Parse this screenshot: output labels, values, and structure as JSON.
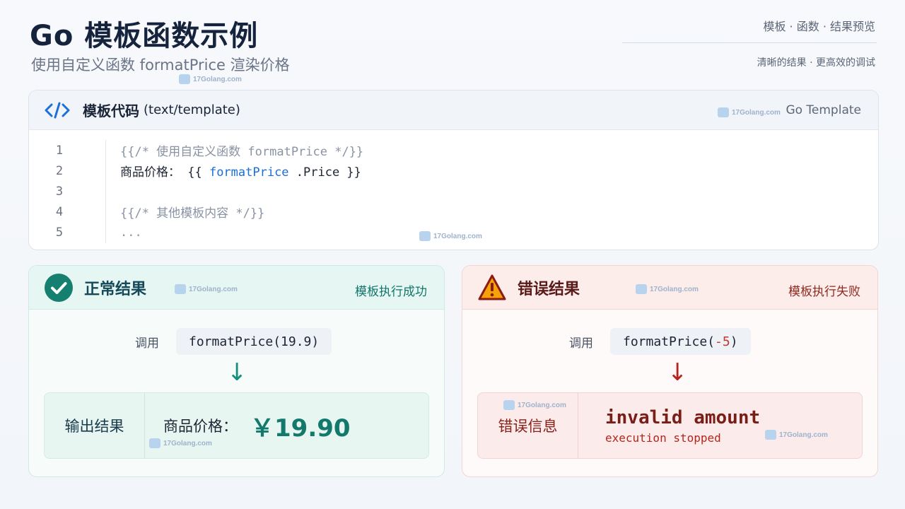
{
  "header": {
    "title": "Go 模板函数示例",
    "subtitle": "使用自定义函数 formatPrice 渲染价格",
    "top_right_line1": "模板 · 函数 · 结果预览",
    "top_right_line2": "清晰的结果  ·  更高效的调试"
  },
  "watermark_text": "17Golang.com",
  "code_card": {
    "title": "模板代码",
    "title_sub": "(text/template)",
    "lang": "Go Template",
    "lines": [
      {
        "no": "1",
        "parts": [
          {
            "t": "{{/* 使用自定义函数 formatPrice */}}",
            "c": "cmt"
          }
        ]
      },
      {
        "no": "2",
        "parts": [
          {
            "t": "商品价格： {{ ",
            "c": ""
          },
          {
            "t": "formatPrice",
            "c": "fn"
          },
          {
            "t": " .Price }}",
            "c": ""
          }
        ]
      },
      {
        "no": "3",
        "parts": []
      },
      {
        "no": "4",
        "parts": [
          {
            "t": "{{/* 其他模板内容 */}}",
            "c": "cmt"
          }
        ]
      },
      {
        "no": "5",
        "parts": [
          {
            "t": "...",
            "c": "cmt"
          }
        ]
      }
    ]
  },
  "ok_card": {
    "title": "正常结果",
    "status": "模板执行成功",
    "call_label": "调用",
    "call_code": "formatPrice(19.9)",
    "arrow": "↓",
    "out_label": "输出结果",
    "out_prefix": "商品价格：",
    "out_value": "￥19.90"
  },
  "err_card": {
    "title": "错误结果",
    "status": "模板执行失败",
    "call_label": "调用",
    "call_code_pre": "formatPrice(",
    "call_code_neg": "-5",
    "call_code_post": ")",
    "arrow": "↓",
    "out_label": "错误信息",
    "err_main": "invalid amount",
    "err_sub": "execution stopped"
  },
  "colors": {
    "ok_accent": "#13796d",
    "err_accent": "#b4261d",
    "code_fn": "#1a6fd8"
  },
  "icons": {
    "code": "code-brackets-icon",
    "ok": "check-circle-icon",
    "err": "warning-triangle-icon"
  }
}
